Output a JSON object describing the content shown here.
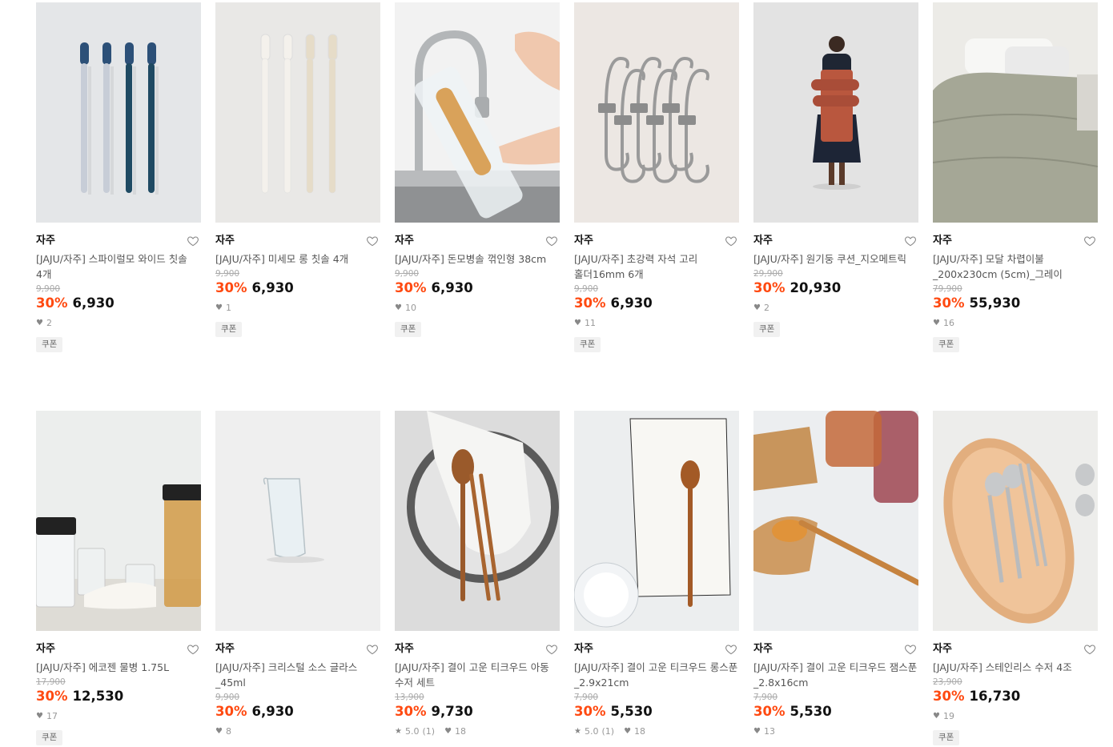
{
  "products": [
    {
      "brand": "자주",
      "title": "[JAJU/자주] 스파이럴모 와이드 칫솔 4개",
      "original_price": "9,900",
      "discount": "30%",
      "price": "6,930",
      "likes": "2",
      "rating": "",
      "reviews": "",
      "badge": "쿠폰",
      "image": "toothbrush-navy"
    },
    {
      "brand": "자주",
      "title": "[JAJU/자주] 미세모 롱 칫솔 4개",
      "original_price": "9,900",
      "discount": "30%",
      "price": "6,930",
      "likes": "1",
      "rating": "",
      "reviews": "",
      "badge": "쿠폰",
      "image": "toothbrush-beige"
    },
    {
      "brand": "자주",
      "title": "[JAJU/자주] 돈모병솔 꺾인형 38cm",
      "original_price": "9,900",
      "discount": "30%",
      "price": "6,930",
      "likes": "10",
      "rating": "",
      "reviews": "",
      "badge": "쿠폰",
      "image": "bottle-brush"
    },
    {
      "brand": "자주",
      "title": "[JAJU/자주] 초강력 자석 고리 홀더16mm 6개",
      "original_price": "9,900",
      "discount": "30%",
      "price": "6,930",
      "likes": "11",
      "rating": "",
      "reviews": "",
      "badge": "쿠폰",
      "image": "magnet-hooks"
    },
    {
      "brand": "자주",
      "title": "[JAJU/자주] 원기둥 쿠션_지오메트릭",
      "original_price": "29,900",
      "discount": "30%",
      "price": "20,930",
      "likes": "2",
      "rating": "",
      "reviews": "",
      "badge": "쿠폰",
      "image": "cushion-model"
    },
    {
      "brand": "자주",
      "title": "[JAJU/자주] 모달 차렵이불 _200x230cm (5cm)_그레이",
      "original_price": "79,900",
      "discount": "30%",
      "price": "55,930",
      "likes": "16",
      "rating": "",
      "reviews": "",
      "badge": "쿠폰",
      "image": "duvet"
    },
    {
      "brand": "자주",
      "title": "[JAJU/자주] 에코젠 물병 1.75L",
      "original_price": "17,900",
      "discount": "30%",
      "price": "12,530",
      "likes": "17",
      "rating": "",
      "reviews": "",
      "badge": "쿠폰",
      "image": "water-bottle"
    },
    {
      "brand": "자주",
      "title": "[JAJU/자주] 크리스털 소스 글라스 _45ml",
      "original_price": "9,900",
      "discount": "30%",
      "price": "6,930",
      "likes": "8",
      "rating": "",
      "reviews": "",
      "badge": "",
      "image": "sauce-glass"
    },
    {
      "brand": "자주",
      "title": "[JAJU/자주] 결이 고운 티크우드 아동 수저 세트",
      "original_price": "13,900",
      "discount": "30%",
      "price": "9,730",
      "likes": "18",
      "rating": "5.0",
      "reviews": "(1)",
      "badge": "",
      "image": "kids-spoon-set"
    },
    {
      "brand": "자주",
      "title": "[JAJU/자주] 결이 고운 티크우드 롱스푼_2.9x21cm",
      "original_price": "7,900",
      "discount": "30%",
      "price": "5,530",
      "likes": "18",
      "rating": "5.0",
      "reviews": "(1)",
      "badge": "",
      "image": "long-spoon"
    },
    {
      "brand": "자주",
      "title": "[JAJU/자주] 결이 고운 티크우드 잼스푼_2.8x16cm",
      "original_price": "7,900",
      "discount": "30%",
      "price": "5,530",
      "likes": "13",
      "rating": "",
      "reviews": "",
      "badge": "",
      "image": "jam-spoon"
    },
    {
      "brand": "자주",
      "title": "[JAJU/자주] 스테인리스 수저 4조",
      "original_price": "23,900",
      "discount": "30%",
      "price": "16,730",
      "likes": "19",
      "rating": "",
      "reviews": "",
      "badge": "쿠폰",
      "image": "stainless-cutlery"
    }
  ],
  "colors": {
    "discount": "#ff4a11",
    "price": "#111111",
    "muted": "#aaaaaa"
  }
}
